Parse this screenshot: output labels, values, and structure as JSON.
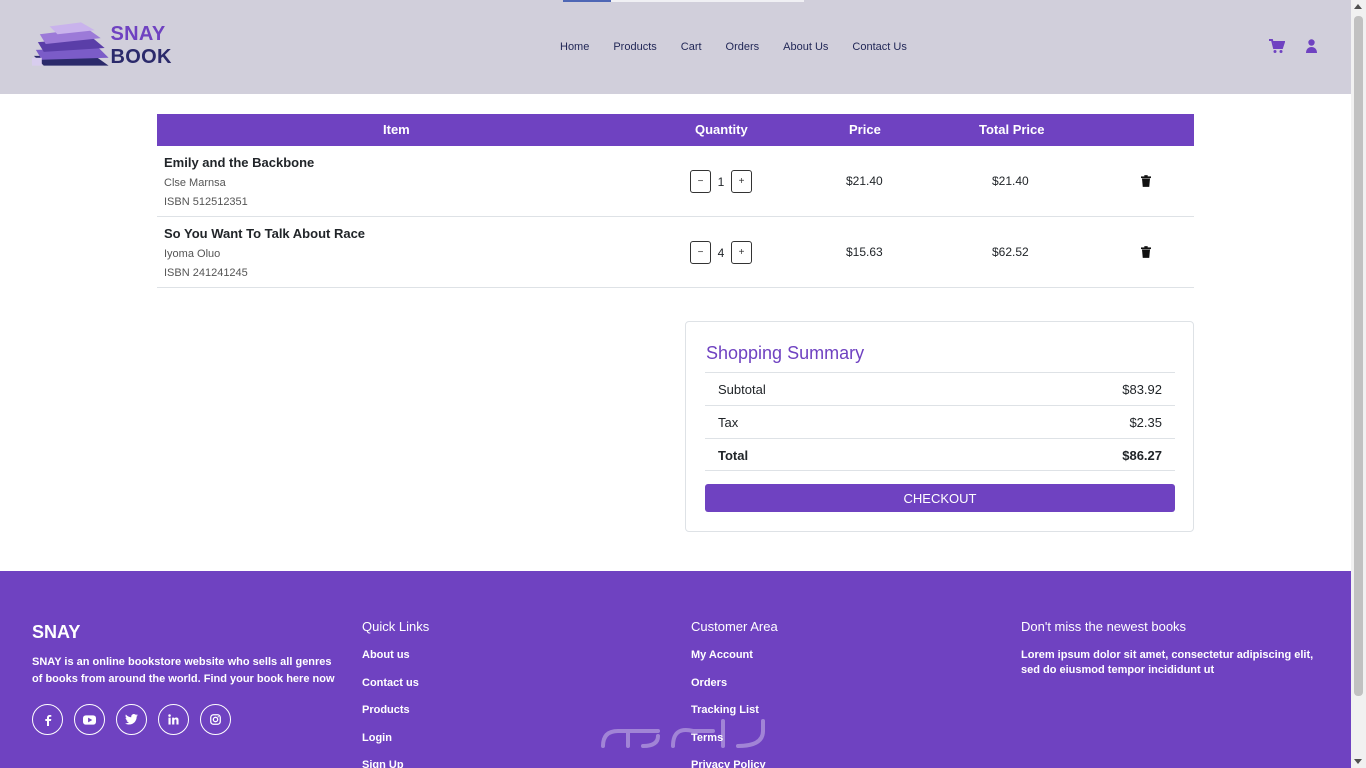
{
  "brand": {
    "part1": "SNAY ",
    "part2": "BOOK"
  },
  "nav": [
    "Home",
    "Products",
    "Cart",
    "Orders",
    "About Us",
    "Contact Us"
  ],
  "icons": {
    "cart": "cart-icon",
    "user": "user-icon",
    "trash": "trash-icon",
    "book_logo": "books-logo"
  },
  "colors": {
    "accent": "#6f42c1",
    "header_bg": "#d1cfdb"
  },
  "cart": {
    "headers": {
      "item": "Item",
      "quantity": "Quantity",
      "price": "Price",
      "total": "Total Price"
    },
    "rows": [
      {
        "title": "Emily and the Backbone",
        "author": "Clse Marnsa",
        "isbn": "ISBN 512512351",
        "qty": "1",
        "price": "$21.40",
        "total": "$21.40"
      },
      {
        "title": "So You Want To Talk About Race",
        "author": "Iyoma Oluo",
        "isbn": "ISBN 241241245",
        "qty": "4",
        "price": "$15.63",
        "total": "$62.52"
      }
    ],
    "minus": "−",
    "plus": "+"
  },
  "summary": {
    "title": "Shopping Summary",
    "subtotal_label": "Subtotal",
    "subtotal": "$83.92",
    "tax_label": "Tax",
    "tax": "$2.35",
    "total_label": "Total",
    "total": "$86.27",
    "checkout": "CHECKOUT"
  },
  "footer": {
    "brand": "SNAY",
    "description": "SNAY is an online bookstore website who sells all genres of books from around the world. Find your book here now",
    "quick_title": "Quick Links",
    "quick_links": [
      "About us",
      "Contact us",
      "Products",
      "Login",
      "Sign Up"
    ],
    "customer_title": "Customer Area",
    "customer_links": [
      "My Account",
      "Orders",
      "Tracking List",
      "Terms",
      "Privacy Policy"
    ],
    "news_title": "Don't miss the newest books",
    "news_text": "Lorem ipsum dolor sit amet, consectetur adipiscing elit, sed do eiusmod tempor incididunt ut",
    "social": [
      "facebook-icon",
      "youtube-icon",
      "twitter-icon",
      "linkedin-icon",
      "instagram-icon"
    ]
  }
}
